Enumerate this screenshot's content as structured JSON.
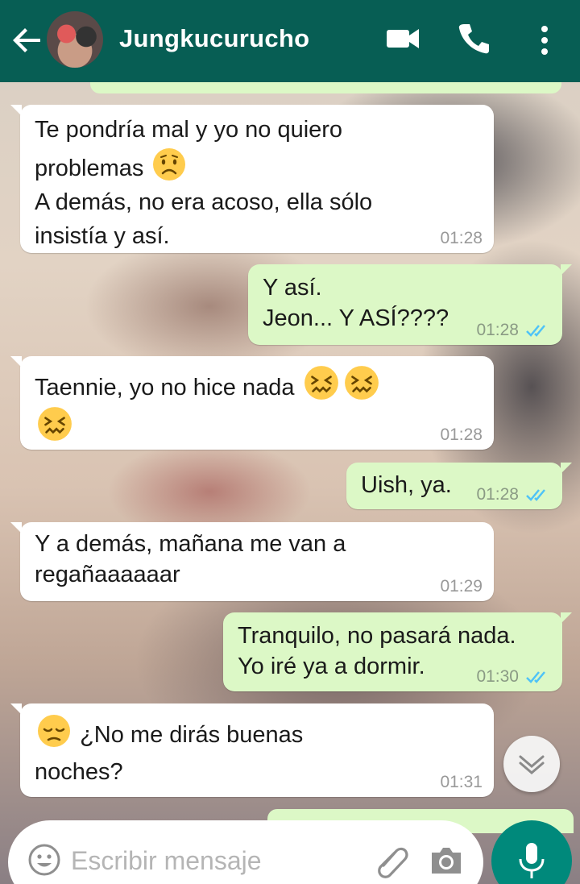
{
  "header": {
    "contact_name": "Jungkucurucho"
  },
  "messages": [
    {
      "dir": "in",
      "lines": [
        "Te pondría mal y yo no quiero",
        "problemas"
      ],
      "extra": "A demás, no era acoso, ella sólo insistía y así.",
      "time": "01:28"
    },
    {
      "dir": "out",
      "line1": "Y así.",
      "line2": "Jeon... Y ASÍ????",
      "time": "01:28"
    },
    {
      "dir": "in",
      "text": "Taennie, yo no hice nada",
      "time": "01:28"
    },
    {
      "dir": "out",
      "text": "Uish, ya.",
      "time": "01:28"
    },
    {
      "dir": "in",
      "line1": "Y a demás, mañana me van a",
      "line2": "regañaaaaaar",
      "time": "01:29"
    },
    {
      "dir": "out",
      "line1": "Tranquilo, no pasará nada.",
      "line2": "Yo iré ya a dormir.",
      "time": "01:30"
    },
    {
      "dir": "in",
      "line1": "¿No me dirás buenas",
      "line2": "noches?",
      "time": "01:31"
    }
  ],
  "msg1": {
    "l1": "Te pondría mal y yo no quiero",
    "l2": "problemas",
    "l3": "A demás, no era acoso, ella sólo",
    "l4": "insistía y así."
  },
  "input": {
    "placeholder": "Escribir mensaje"
  },
  "colors": {
    "header": "#075e54",
    "outgoing_bubble": "#dcf8c6",
    "incoming_bubble": "#ffffff",
    "read_ticks": "#4fc3f7",
    "mic_button": "#00897b"
  },
  "icons": [
    "back-arrow-icon",
    "video-call-icon",
    "phone-icon",
    "more-vert-icon",
    "emoji-icon",
    "attach-icon",
    "camera-icon",
    "mic-icon",
    "chevron-down-icon",
    "double-check-icon"
  ]
}
